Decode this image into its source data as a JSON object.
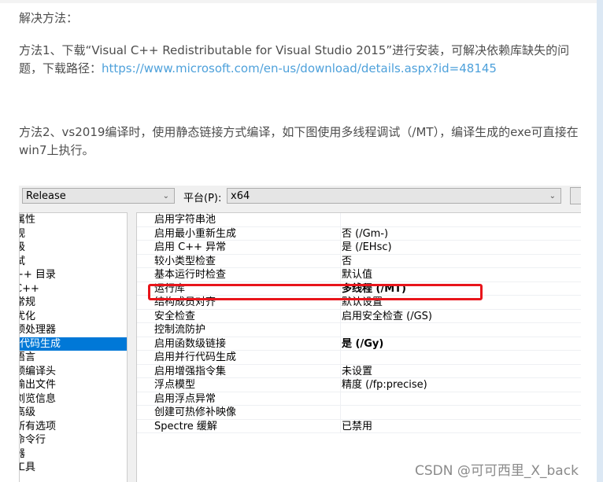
{
  "article": {
    "p1": "解决方法：",
    "p2_text": "方法1、下载“Visual C++ Redistributable for Visual Studio 2015”进行安装，可解决依赖库缺失的问题，下载路径：",
    "p2_link": "https://www.microsoft.com/en-us/download/details.aspx?id=48145",
    "p3": "方法2、vs2019编译时，使用静态链接方式编译，如下图使用多线程调试（/MT），编译生成的exe可直接在win7上执行。"
  },
  "screenshot": {
    "config": "Release",
    "platform_label": "平台(P):",
    "platform": "x64",
    "tree": [
      "属性",
      "规",
      "级",
      "试",
      "++ 目录",
      "C++",
      "常规",
      "优化",
      "预处理器",
      "代码生成",
      "语言",
      "预编译头",
      "输出文件",
      "浏览信息",
      "高级",
      "所有选项",
      "命令行",
      "器",
      "工具"
    ],
    "selected_tree_index": 9,
    "properties": [
      {
        "name": "启用字符串池",
        "value": ""
      },
      {
        "name": "启用最小重新生成",
        "value": "否 (/Gm-)"
      },
      {
        "name": "启用 C++ 异常",
        "value": "是 (/EHsc)"
      },
      {
        "name": "较小类型检查",
        "value": "否"
      },
      {
        "name": "基本运行时检查",
        "value": "默认值"
      },
      {
        "name": "运行库",
        "value": "多线程 (/MT)",
        "bold": true
      },
      {
        "name": "结构成员对齐",
        "value": "默认设置"
      },
      {
        "name": "安全检查",
        "value": "启用安全检查 (/GS)"
      },
      {
        "name": "控制流防护",
        "value": ""
      },
      {
        "name": "启用函数级链接",
        "value": "是 (/Gy)",
        "bold": true
      },
      {
        "name": "启用并行代码生成",
        "value": ""
      },
      {
        "name": "启用增强指令集",
        "value": "未设置"
      },
      {
        "name": "浮点模型",
        "value": "精度 (/fp:precise)"
      },
      {
        "name": "启用浮点异常",
        "value": ""
      },
      {
        "name": "创建可热修补映像",
        "value": ""
      },
      {
        "name": "Spectre 缓解",
        "value": "已禁用"
      }
    ],
    "highlight_color": "#e8151b",
    "selection_color": "#0078d7"
  },
  "watermark": "CSDN @可可西里_X_back"
}
